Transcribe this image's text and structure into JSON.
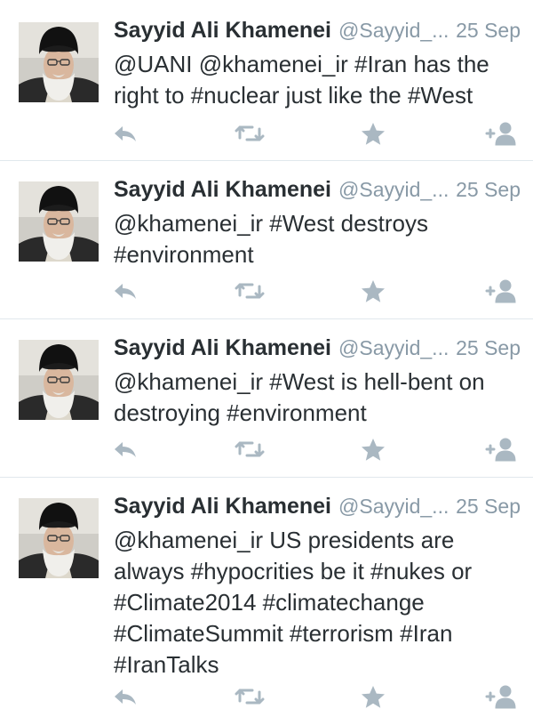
{
  "tweets": [
    {
      "name": "Sayyid Ali Khamenei",
      "handle": "@Sayyid_...",
      "time": "25 Sep",
      "text": "@UANI @khamenei_ir #Iran has the right to #nuclear just like the #West"
    },
    {
      "name": "Sayyid Ali Khamenei",
      "handle": "@Sayyid_...",
      "time": "25 Sep",
      "text": "@khamenei_ir #West destroys #environment"
    },
    {
      "name": "Sayyid Ali Khamenei",
      "handle": "@Sayyid_...",
      "time": "25 Sep",
      "text": "@khamenei_ir #West is hell-bent on destroying #environment"
    },
    {
      "name": "Sayyid Ali Khamenei",
      "handle": "@Sayyid_...",
      "time": "25 Sep",
      "text": "@khamenei_ir US presidents are always #hypocrities be it #nukes or #Climate2014 #climatechange #ClimateSummit #terrorism #Iran #IranTalks"
    }
  ],
  "icons": {
    "reply": "reply-icon",
    "retweet": "retweet-icon",
    "favorite": "star-icon",
    "follow": "follow-icon"
  },
  "colors": {
    "name": "#292f33",
    "meta": "#8899a6",
    "icon": "#aab8c2",
    "divider": "#e1e8ed"
  }
}
